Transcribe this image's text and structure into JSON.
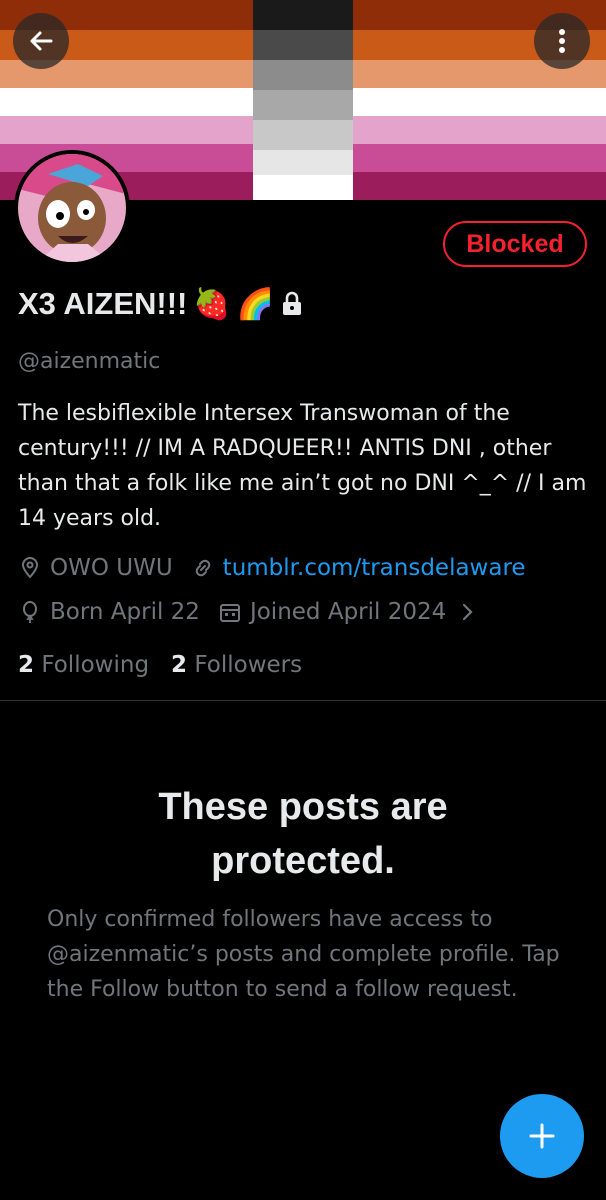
{
  "header": {
    "back_icon": "arrow-left-icon",
    "more_icon": "more-vertical-icon",
    "banner_colors": [
      "#8f2d09",
      "#c95a18",
      "#e5986c",
      "#ffffff",
      "#e3a3cb",
      "#c94c96",
      "#9c1d5c"
    ]
  },
  "profile": {
    "blocked_label": "Blocked",
    "display_name": "X3 AIZEN!!!",
    "name_emojis": [
      "🍓",
      "🌈"
    ],
    "lock_icon": "lock-icon",
    "handle": "@aizenmatic",
    "bio": "The lesbiflexible Intersex Transwoman of the century!!! // IM A RADQUEER!! ANTIS DNI , other than that a folk like me ain’t got no DNI ^_^ // I am 14 years old.",
    "location": "OWO UWU",
    "website": "tumblr.com/transdelaware",
    "birthday": "Born April 22",
    "joined": "Joined April 2024",
    "following_count": "2",
    "following_label": "Following",
    "followers_count": "2",
    "followers_label": "Followers"
  },
  "protected": {
    "title": "These posts are protected.",
    "description": "Only confirmed followers have access to @aizenmatic’s posts and complete profile. Tap the Follow button to send a follow request."
  },
  "fab": {
    "icon": "plus-icon"
  },
  "colors": {
    "accent": "#1d9bf0",
    "blocked": "#f4212e",
    "muted": "#71767b",
    "text": "#e7e9ea"
  }
}
